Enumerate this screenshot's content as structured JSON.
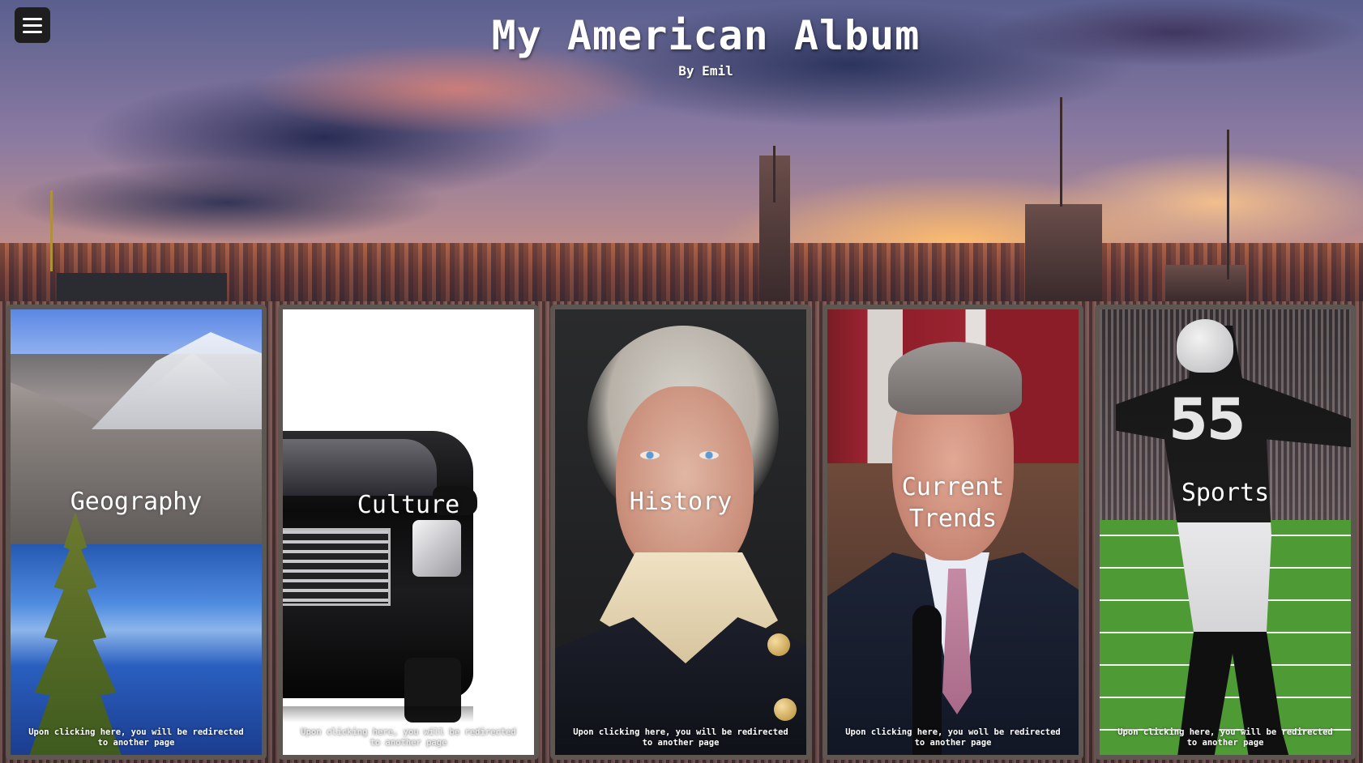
{
  "header": {
    "title": "My American Album",
    "subtitle": "By Emil"
  },
  "menu": {
    "icon": "hamburger-menu-icon"
  },
  "cards": [
    {
      "title": "Geography",
      "note": "Upon clicking here, you will be redirected to another page"
    },
    {
      "title": "Culture",
      "note": "Upon clicking here, you will be redirected to another page"
    },
    {
      "title": "History",
      "note": "Upon clicking here, you will be redirected to another page"
    },
    {
      "title": "Current Trends",
      "note": "Upon clicking here, you woll be redirected to another page"
    },
    {
      "title": "Sports",
      "note": "Upon clicking here, you will be redirected to another page"
    }
  ],
  "sports_image": {
    "jersey_number": "55"
  },
  "colors": {
    "card_border": "#5e5650",
    "menu_button_bg": "#1e1e1e",
    "text": "#ffffff"
  }
}
